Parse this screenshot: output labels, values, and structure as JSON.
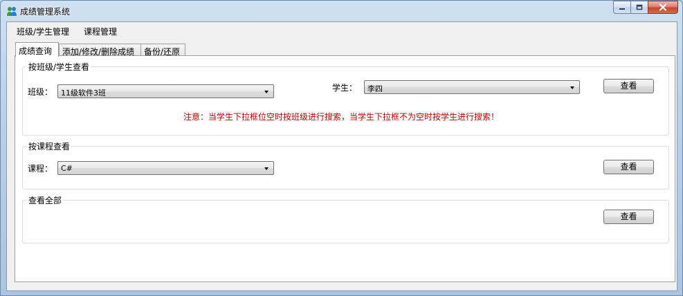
{
  "window": {
    "title": "成绩管理系统"
  },
  "menu": {
    "items": [
      "班级/学生管理",
      "课程管理"
    ]
  },
  "tabs": [
    "成绩查询",
    "添加/修改/删除成绩",
    "备份/还原"
  ],
  "by_class_student": {
    "group_title": "按班级/学生查看",
    "class_label": "班级：",
    "class_value": "11级软件3班",
    "student_label": "学生：",
    "student_value": "李四",
    "view_button": "查看",
    "note": "注意：当学生下拉框位空时按班级进行搜索，当学生下拉框不为空时按学生进行搜索！"
  },
  "by_course": {
    "group_title": "按课程查看",
    "course_label": "课程：",
    "course_value": "C#",
    "view_button": "查看"
  },
  "view_all": {
    "group_title": "查看全部",
    "view_button": "查看"
  },
  "colors": {
    "note_text": "#c00000",
    "close_button": "#c8462c"
  }
}
